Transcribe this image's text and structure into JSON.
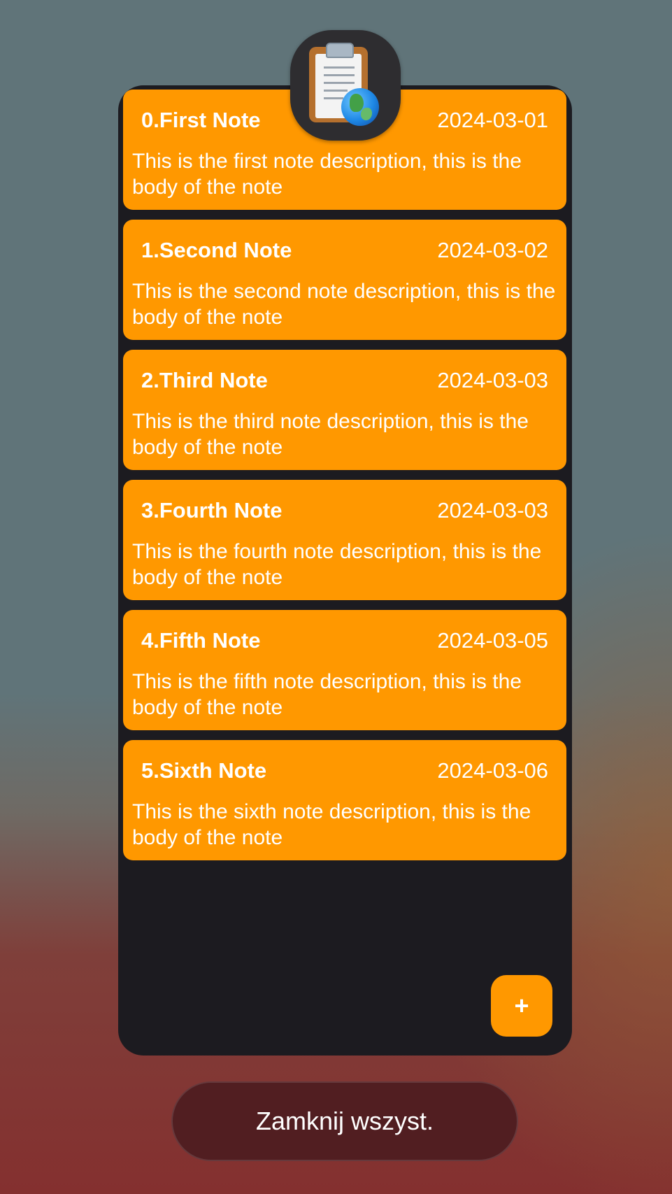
{
  "app": {
    "icon": "clipboard-globe-icon"
  },
  "notes": [
    {
      "title": "0.First Note",
      "date": "2024-03-01",
      "body": "This is the first note description, this is the body of the note"
    },
    {
      "title": "1.Second Note",
      "date": "2024-03-02",
      "body": "This is the second note description, this is the body of the note"
    },
    {
      "title": "2.Third Note",
      "date": "2024-03-03",
      "body": "This is the third note description, this is the body of the note"
    },
    {
      "title": "3.Fourth Note",
      "date": "2024-03-03",
      "body": "This is the fourth note description, this is the body of the note"
    },
    {
      "title": "4.Fifth Note",
      "date": "2024-03-05",
      "body": "This is the fifth note description, this is the body of the note"
    },
    {
      "title": "5.Sixth Note",
      "date": "2024-03-06",
      "body": "This is the sixth note description, this is the body of the note"
    }
  ],
  "fab": {
    "label": "+",
    "icon": "plus-icon"
  },
  "recents": {
    "close_all_label": "Zamknij wszyst."
  },
  "colors": {
    "accent": "#ff9800",
    "card_background": "#1c1b20",
    "text": "#ffffff"
  }
}
